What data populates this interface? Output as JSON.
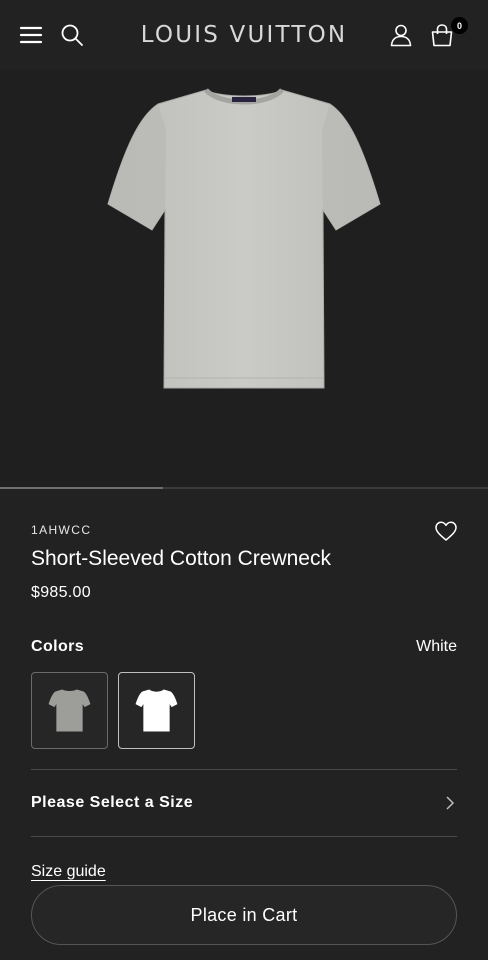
{
  "header": {
    "brand": "LOUIS VUITTON",
    "cart_count": "0",
    "icons": [
      "menu-icon",
      "search-icon",
      "account-icon",
      "bag-icon"
    ]
  },
  "product": {
    "sku": "1AHWCC",
    "name": "Short-Sleeved Cotton Crewneck",
    "price": "$985.00",
    "wishlist_icon": "heart-icon"
  },
  "colors": {
    "label": "Colors",
    "selected": "White",
    "swatches": [
      {
        "name": "Grey",
        "color": "#9d9d9a"
      },
      {
        "name": "White",
        "color": "#ffffff"
      }
    ]
  },
  "size": {
    "label": "Please Select a Size",
    "guide": "Size guide"
  },
  "actions": {
    "cart_button": "Place in Cart"
  },
  "theme": {
    "background": "#222222",
    "shirt": "#c8c8c4"
  }
}
